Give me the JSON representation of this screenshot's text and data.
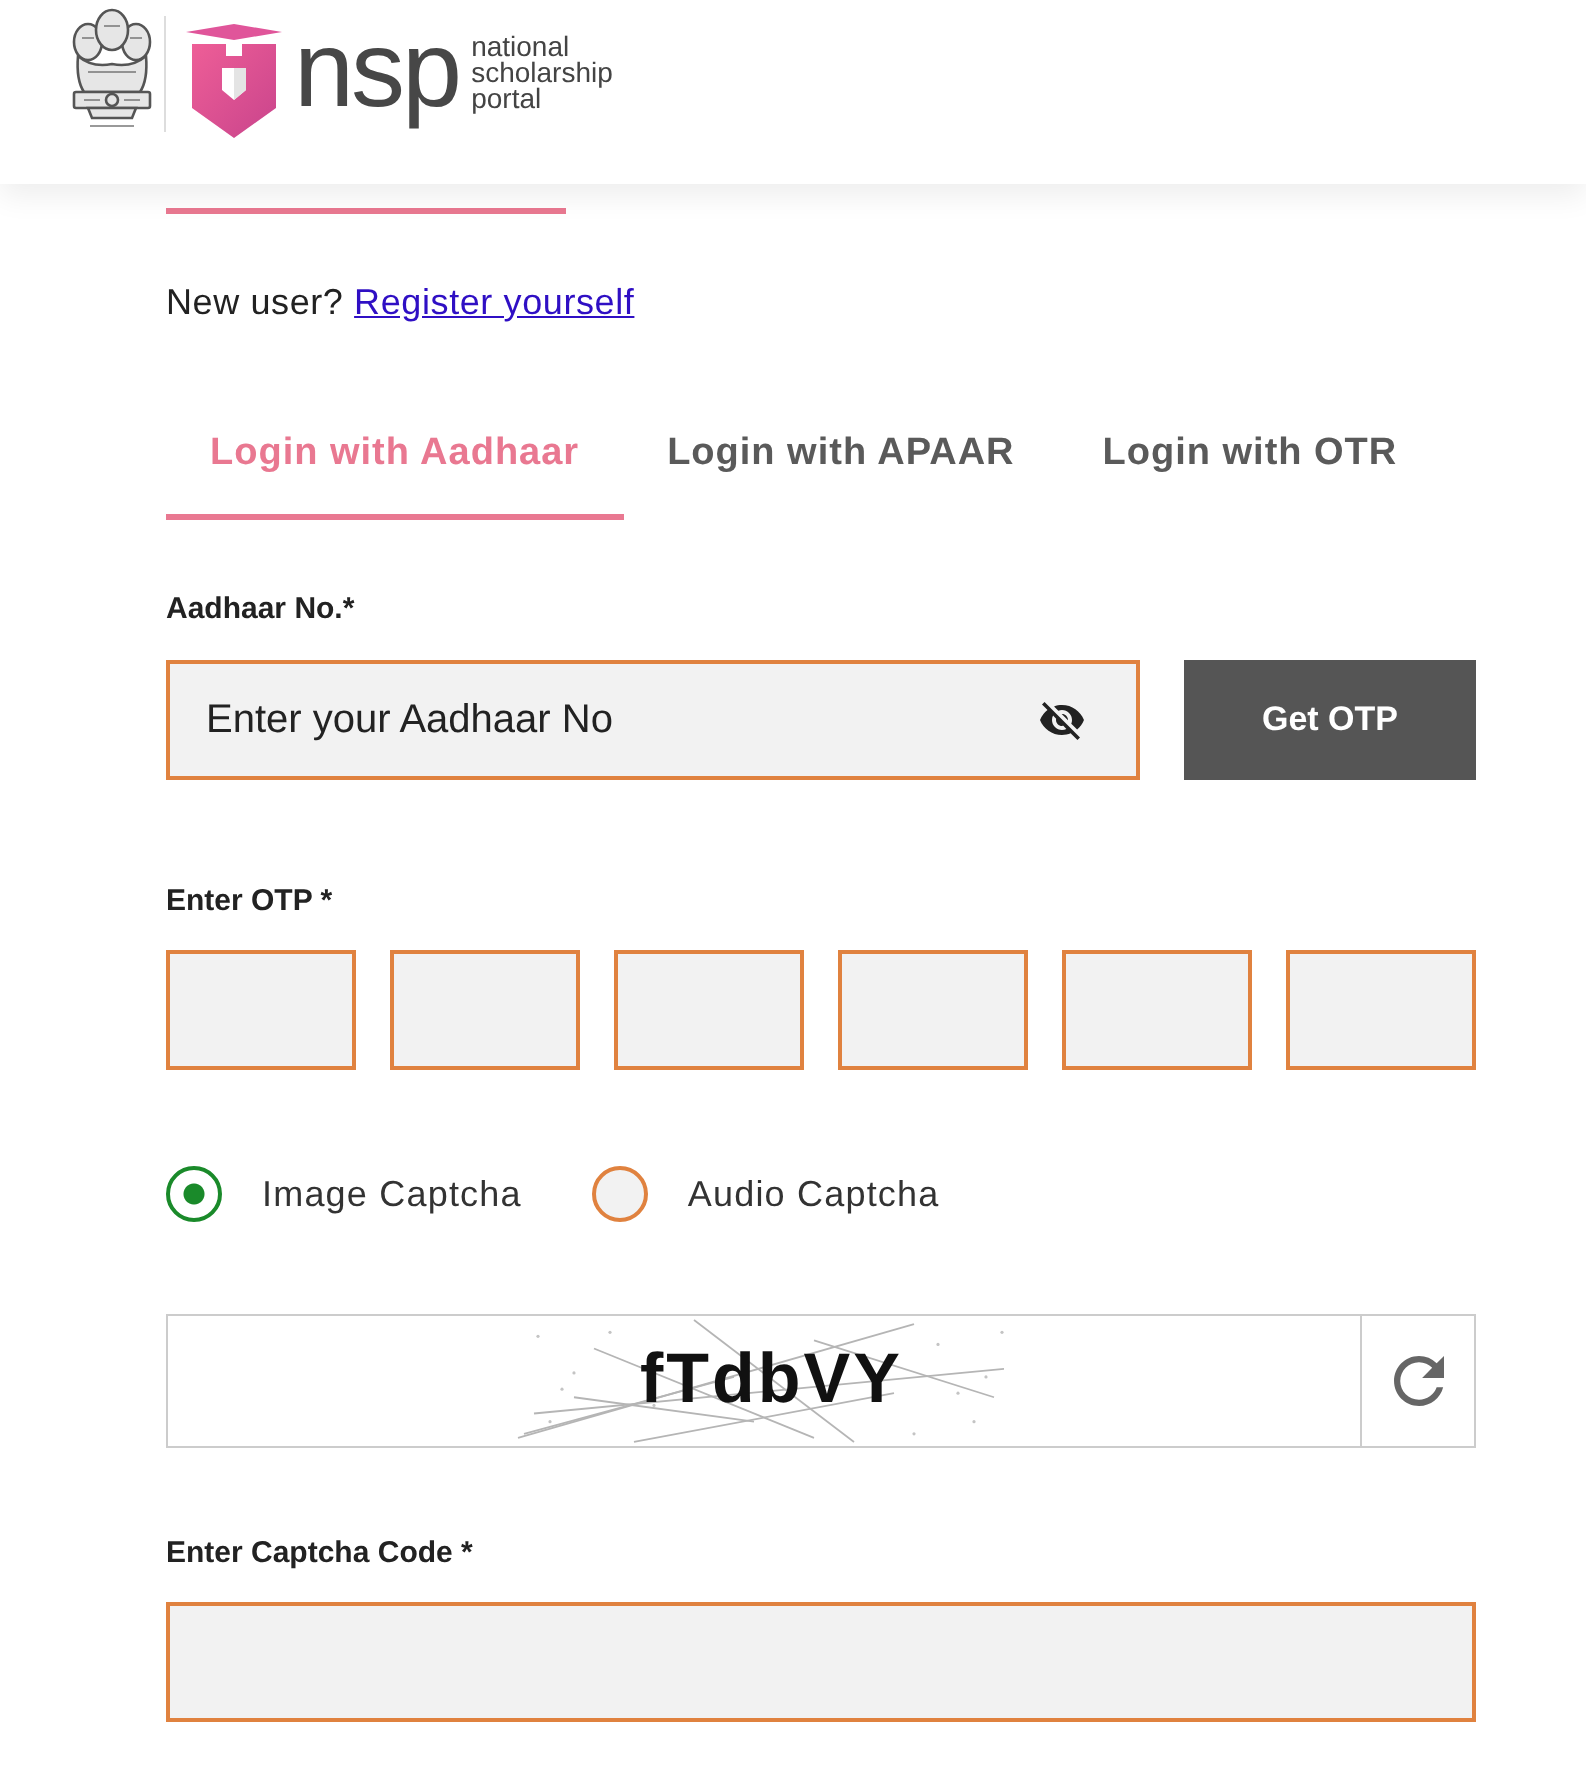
{
  "header": {
    "logo_text": "nsp",
    "tagline": "national scholarship portal"
  },
  "register_prompt": {
    "text": "New user?",
    "link": "Register yourself"
  },
  "tabs": [
    {
      "label": "Login with Aadhaar",
      "selected": true
    },
    {
      "label": "Login with APAAR",
      "selected": false
    },
    {
      "label": "Login with OTR",
      "selected": false
    }
  ],
  "aadhaar": {
    "label": "Aadhaar No.*",
    "placeholder": "Enter your Aadhaar No",
    "button": "Get OTP"
  },
  "otp": {
    "label": "Enter OTP *",
    "boxes": [
      {
        "kind": "digit"
      },
      {
        "kind": "digit"
      },
      {
        "kind": "digit"
      },
      {
        "kind": "digit"
      },
      {
        "kind": "digit"
      },
      {
        "kind": "digit"
      }
    ]
  },
  "captcha_type": {
    "options": [
      {
        "label": "Image Captcha",
        "selected": true
      },
      {
        "label": "Audio Captcha",
        "selected": false
      }
    ]
  },
  "captcha": {
    "code": "fTdbVY"
  },
  "captcha_input": {
    "label": "Enter Captcha Code *"
  }
}
